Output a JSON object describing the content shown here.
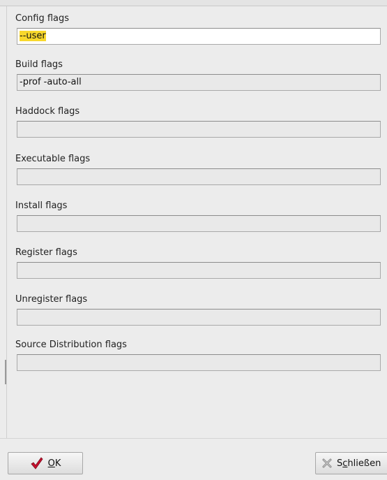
{
  "fields": [
    {
      "label": "Config flags",
      "value_selected": "--user",
      "value": ""
    },
    {
      "label": "Build flags",
      "value": "-prof -auto-all"
    },
    {
      "label": "Haddock flags",
      "value": ""
    },
    {
      "label": "Executable flags",
      "value": ""
    },
    {
      "label": "Install flags",
      "value": ""
    },
    {
      "label": "Register flags",
      "value": ""
    },
    {
      "label": "Unregister flags",
      "value": ""
    },
    {
      "label": "Source Distribution flags",
      "value": ""
    }
  ],
  "buttons": {
    "ok": {
      "mnemonic": "O",
      "rest": "K",
      "icon": "checkmark-icon"
    },
    "close": {
      "prefix": "S",
      "mnemonic": "c",
      "rest": "hließen",
      "icon": "close-x-icon"
    }
  },
  "colors": {
    "selection": "#f8d82d",
    "checkmark": "#c8102e",
    "background": "#ececec",
    "input_bg": "#e9e9e9"
  }
}
